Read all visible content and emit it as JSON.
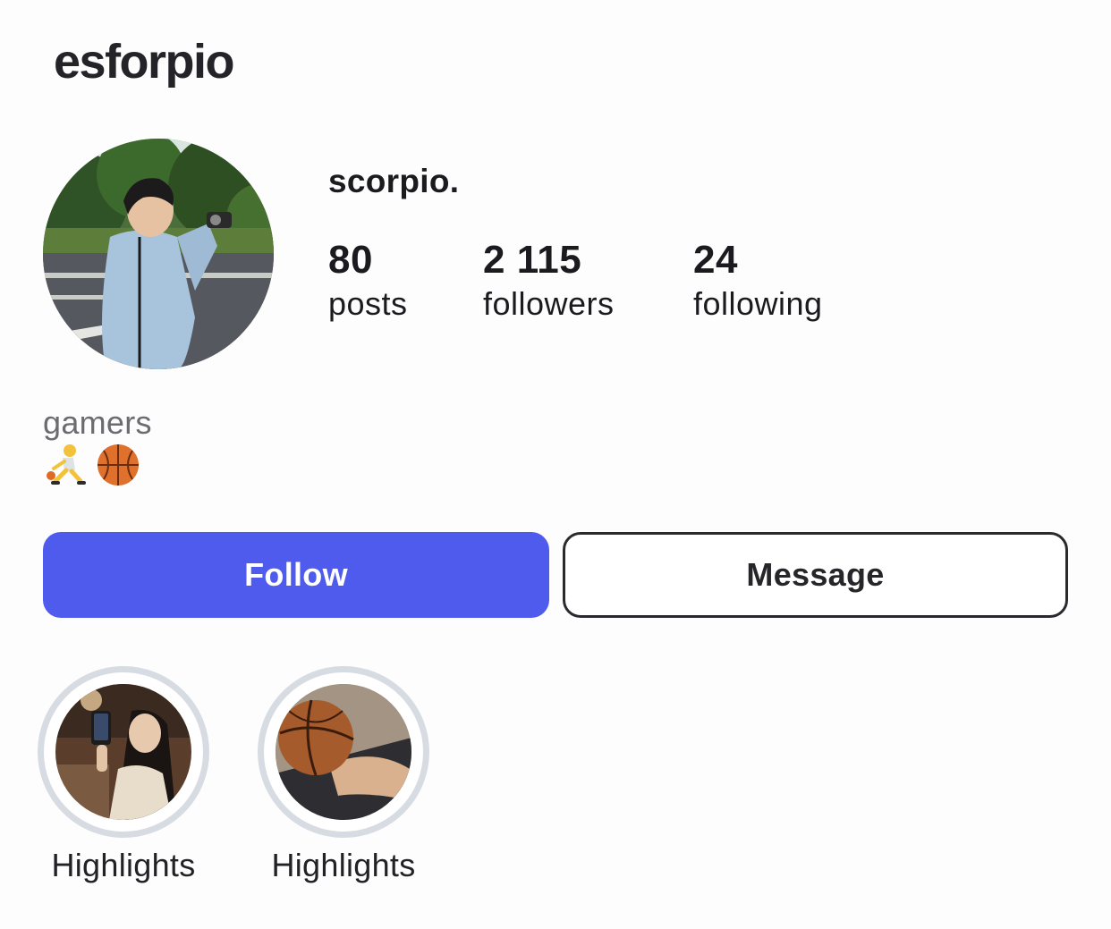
{
  "header": {
    "username": "esforpio"
  },
  "profile": {
    "display_name": "scorpio.",
    "avatar": "profile-photo"
  },
  "stats": [
    {
      "value": "80",
      "label": "posts"
    },
    {
      "value": "2 115",
      "label": "followers"
    },
    {
      "value": "24",
      "label": "following"
    }
  ],
  "bio": {
    "text": "gamers",
    "emojis": [
      "person-bouncing-ball-emoji",
      "basketball-emoji"
    ]
  },
  "actions": {
    "follow_label": "Follow",
    "message_label": "Message"
  },
  "highlights": [
    {
      "label": "Highlights",
      "cover": "photo-person-with-phone"
    },
    {
      "label": "Highlights",
      "cover": "photo-basketball"
    }
  ],
  "colors": {
    "follow_button": "#4f5bed",
    "highlight_ring": "#d7dbe2",
    "secondary_text": "#6b6b70"
  }
}
